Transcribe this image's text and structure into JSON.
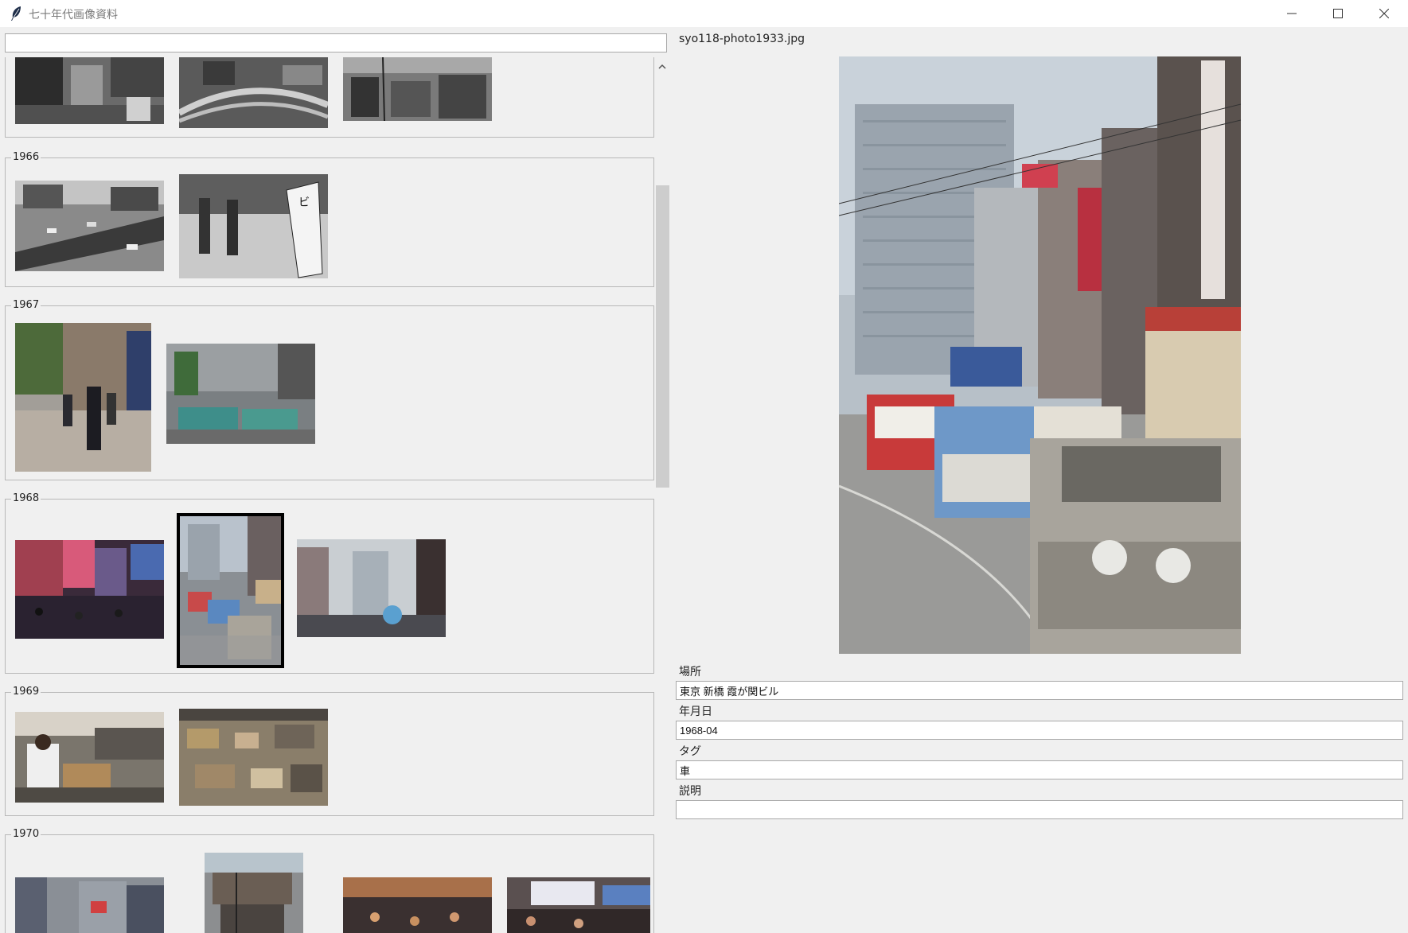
{
  "window": {
    "title": "七十年代画像資料",
    "minimize_icon": "minimize-icon",
    "maximize_icon": "maximize-icon",
    "close_icon": "close-icon"
  },
  "search": {
    "value": "",
    "placeholder": ""
  },
  "gallery": {
    "groups": [
      {
        "year": "",
        "thumbnails": [
          "bw-city-canals",
          "bw-elevated-highway",
          "bw-street-rooftops"
        ]
      },
      {
        "year": "1966",
        "thumbnails": [
          "bw-highway-traffic",
          "bw-police-sign"
        ]
      },
      {
        "year": "1967",
        "thumbnails": [
          "color-street-pedestrians",
          "color-cars-intersection"
        ]
      },
      {
        "year": "1968",
        "thumbnails": [
          "color-night-crowd",
          "color-kasumigaseki-traffic",
          "color-street-crowd"
        ],
        "selected_index": 1
      },
      {
        "year": "1969",
        "thumbnails": [
          "color-market-porter",
          "color-market-aerial"
        ]
      },
      {
        "year": "1970",
        "thumbnails": [
          "color-city-building",
          "color-harbor-structure",
          "color-crowd-market",
          "color-bus-crowd"
        ]
      }
    ]
  },
  "detail": {
    "filename": "syo118-photo1933.jpg",
    "fields": [
      {
        "label": "場所",
        "value": "東京 新橋 霞が関ビル"
      },
      {
        "label": "年月日",
        "value": "1968-04"
      },
      {
        "label": "タグ",
        "value": "車"
      },
      {
        "label": "説明",
        "value": ""
      }
    ]
  },
  "colors": {
    "background": "#f0f0f0",
    "titlebar": "#ffffff",
    "scrollbar_thumb": "#cdcdcd",
    "selection_border": "#000000"
  }
}
